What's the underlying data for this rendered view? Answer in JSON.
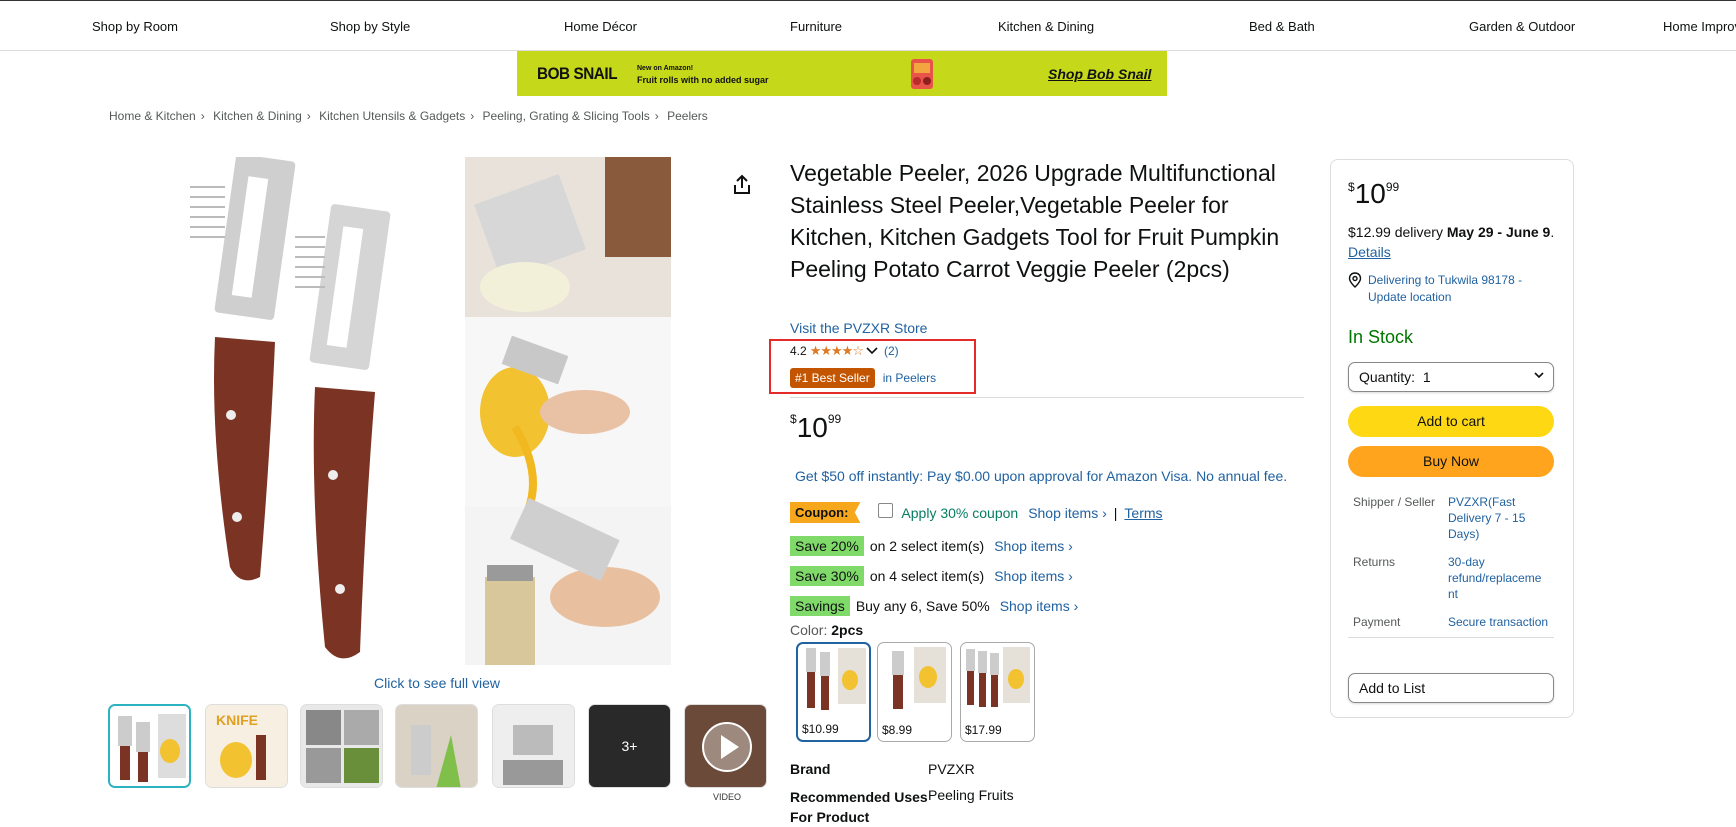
{
  "nav": {
    "items": [
      "Shop by Room",
      "Shop by Style",
      "Home Décor",
      "Furniture",
      "Kitchen & Dining",
      "Bed & Bath",
      "Garden & Outdoor",
      "Home Improv"
    ]
  },
  "banner": {
    "brand": "BOB SNAIL",
    "tag1": "New on Amazon!",
    "tag2": "Fruit rolls with no added sugar",
    "cta": "Shop Bob Snail",
    "bg_color": "#c5d81a"
  },
  "breadcrumb": [
    "Home & Kitchen",
    "Kitchen & Dining",
    "Kitchen Utensils & Gadgets",
    "Peeling, Grating & Slicing Tools",
    "Peelers"
  ],
  "gallery": {
    "full_view": "Click to see full view",
    "more_label": "3+",
    "video_label": "VIDEO"
  },
  "product": {
    "title": "Vegetable Peeler, 2026 Upgrade Multifunctional Stainless Steel Peeler,Vegetable Peeler for Kitchen, Kitchen Gadgets Tool for Fruit Pumpkin Peeling Potato Carrot Veggie Peeler (2pcs)",
    "store": "Visit the PVZXR Store",
    "rating": "4.2",
    "review_count": "(2)",
    "best_seller": "#1 Best Seller",
    "best_seller_cat": "in Peelers",
    "price_symbol": "$",
    "price_whole": "10",
    "price_fraction": "99",
    "visa_offer": "Get $50 off instantly: Pay $0.00 upon approval for Amazon Visa. No annual fee."
  },
  "coupon": {
    "label": "Coupon:",
    "apply": "Apply 30% coupon",
    "shop": "Shop items ›",
    "pipe": "|",
    "terms": "Terms"
  },
  "savings": [
    {
      "badge": "Save 20%",
      "text": "on 2 select item(s)",
      "link": "Shop items ›"
    },
    {
      "badge": "Save 30%",
      "text": "on 4 select item(s)",
      "link": "Shop items ›"
    },
    {
      "badge": "Savings",
      "text": "Buy any 6, Save 50%",
      "link": "Shop items ›"
    }
  ],
  "color": {
    "label": "Color:",
    "selected": "2pcs",
    "options": [
      {
        "price": "$10.99"
      },
      {
        "price": "$8.99"
      },
      {
        "price": "$17.99"
      }
    ]
  },
  "specs": [
    {
      "key": "Brand",
      "value": "PVZXR"
    },
    {
      "key": "Recommended Uses For Product",
      "value": "Peeling Fruits"
    }
  ],
  "buybox": {
    "price_symbol": "$",
    "price_whole": "10",
    "price_fraction": "99",
    "delivery_prefix": "$12.99 delivery",
    "delivery_dates": "May 29 - June 9",
    "delivery_dot": ".",
    "details": "Details",
    "location": "Delivering to Tukwila 98178 - Update location",
    "stock": "In Stock",
    "qty_label": "Quantity:",
    "qty_value": "1",
    "add_to_cart": "Add to cart",
    "buy_now": "Buy Now",
    "shipper_key": "Shipper / Seller",
    "shipper_val": "PVZXR(Fast Delivery 7 - 15 Days)",
    "returns_key": "Returns",
    "returns_val": "30-day refund/replaceme nt",
    "payment_key": "Payment",
    "payment_val": "Secure transaction",
    "add_to_list": "Add to List"
  }
}
